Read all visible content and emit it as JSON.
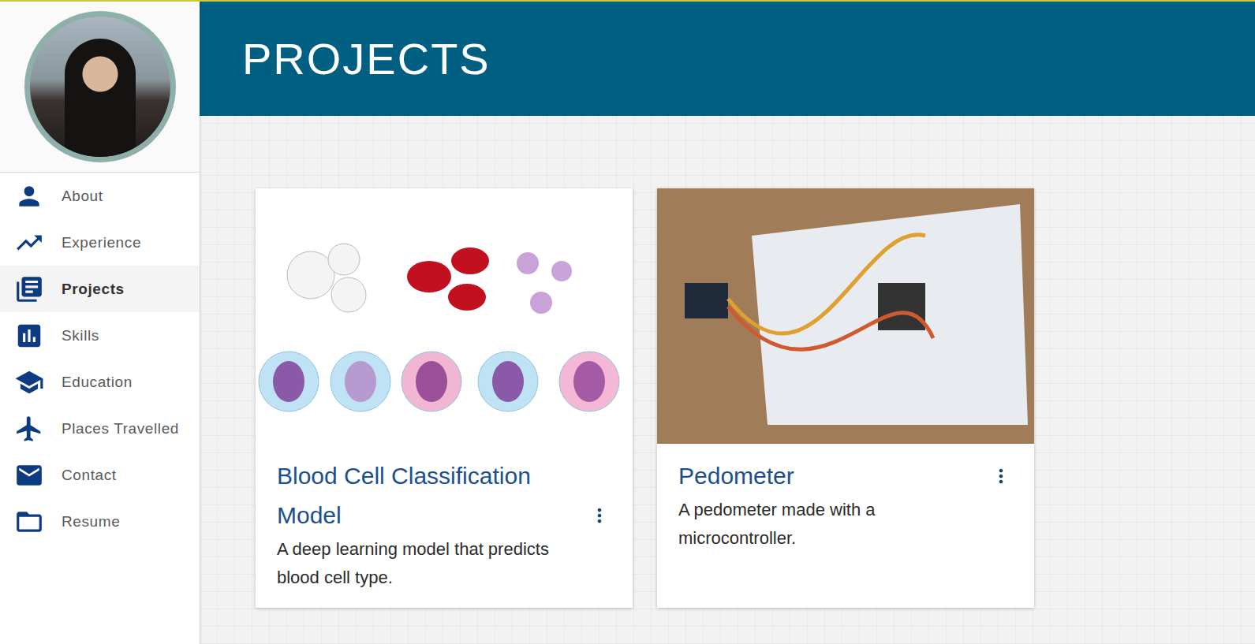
{
  "sidebar": {
    "items": [
      {
        "label": "About",
        "selected": false
      },
      {
        "label": "Experience",
        "selected": false
      },
      {
        "label": "Projects",
        "selected": true
      },
      {
        "label": "Skills",
        "selected": false
      },
      {
        "label": "Education",
        "selected": false
      },
      {
        "label": "Places Travelled",
        "selected": false
      },
      {
        "label": "Contact",
        "selected": false
      },
      {
        "label": "Resume",
        "selected": false
      }
    ]
  },
  "header": {
    "title": "PROJECTS"
  },
  "projects": [
    {
      "title": "Blood Cell Classification Model",
      "description": "A deep learning model that predicts blood cell type.",
      "image": "illustration"
    },
    {
      "title": "Pedometer",
      "description": "A pedometer made with a microcontroller.",
      "image": "photo"
    }
  ]
}
